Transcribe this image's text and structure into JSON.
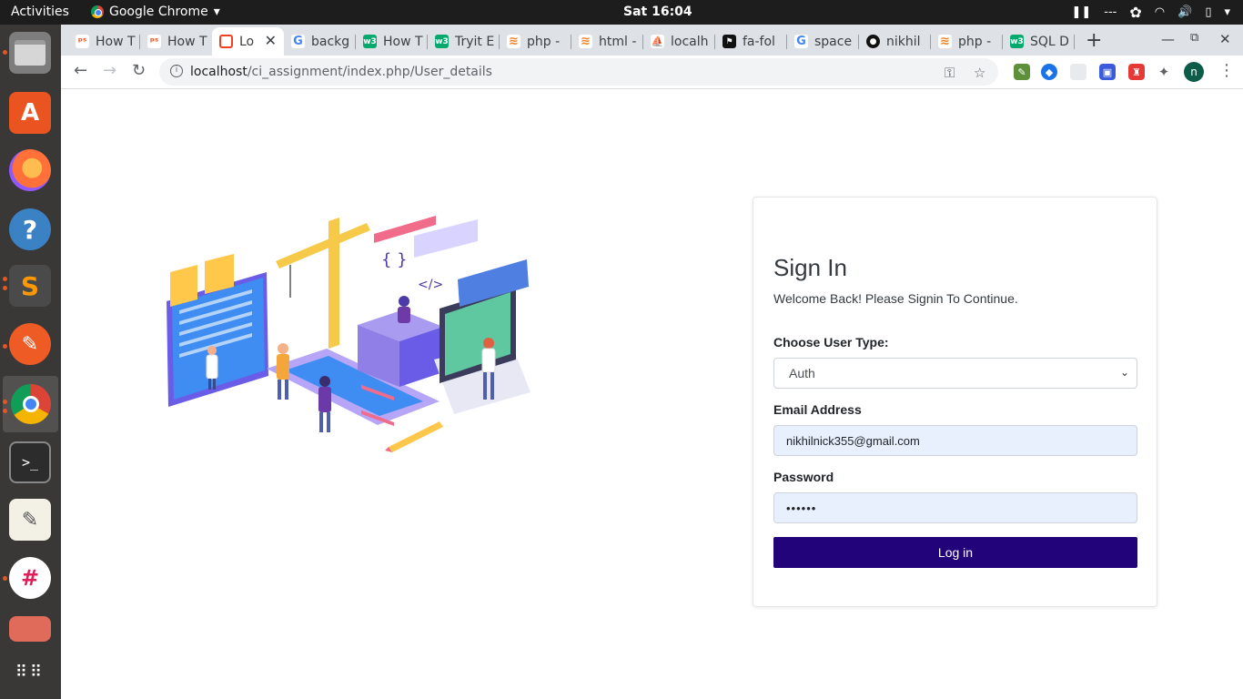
{
  "topbar": {
    "activities": "Activities",
    "app_name": "Google Chrome",
    "clock": "Sat 16:04",
    "tray_text": "---"
  },
  "dock": {
    "items": [
      "file-manager",
      "app-center",
      "firefox",
      "help",
      "sublime-text",
      "postman",
      "chrome",
      "terminal",
      "text-editor",
      "slack",
      "app",
      "show-apps"
    ]
  },
  "tabs": [
    {
      "label": "How T",
      "favicon": "ps-icon"
    },
    {
      "label": "How T",
      "favicon": "ps-icon"
    },
    {
      "label": "Lo",
      "favicon": "codeigniter-icon",
      "active": true
    },
    {
      "label": "backg",
      "favicon": "google-icon"
    },
    {
      "label": "How T",
      "favicon": "w3-icon"
    },
    {
      "label": "Tryit E",
      "favicon": "w3-icon"
    },
    {
      "label": "php -",
      "favicon": "stackoverflow-icon"
    },
    {
      "label": "html -",
      "favicon": "stackoverflow-icon"
    },
    {
      "label": "localh",
      "favicon": "phpmyadmin-icon"
    },
    {
      "label": "fa-fol",
      "favicon": "fontawesome-icon"
    },
    {
      "label": "space",
      "favicon": "google-icon"
    },
    {
      "label": "nikhil",
      "favicon": "github-icon"
    },
    {
      "label": "php -",
      "favicon": "stackoverflow-icon"
    },
    {
      "label": "SQL D",
      "favicon": "w3-icon"
    }
  ],
  "omnibox": {
    "host": "localhost",
    "path": "/ci_assignment/index.php/User_details"
  },
  "profile_initial": "n",
  "signin": {
    "title": "Sign In",
    "welcome": "Welcome Back! Please Signin To Continue.",
    "user_type_label": "Choose User Type:",
    "user_type_value": "Auth",
    "email_label": "Email Address",
    "email_value": "nikhilnick355@gmail.com",
    "password_label": "Password",
    "password_value": "••••••",
    "login_button": "Log in"
  },
  "colors": {
    "login_button": "#23037a",
    "autofill_bg": "#e8f0fe",
    "topbar": "#1d1d1d",
    "dock": "#3a3737"
  }
}
